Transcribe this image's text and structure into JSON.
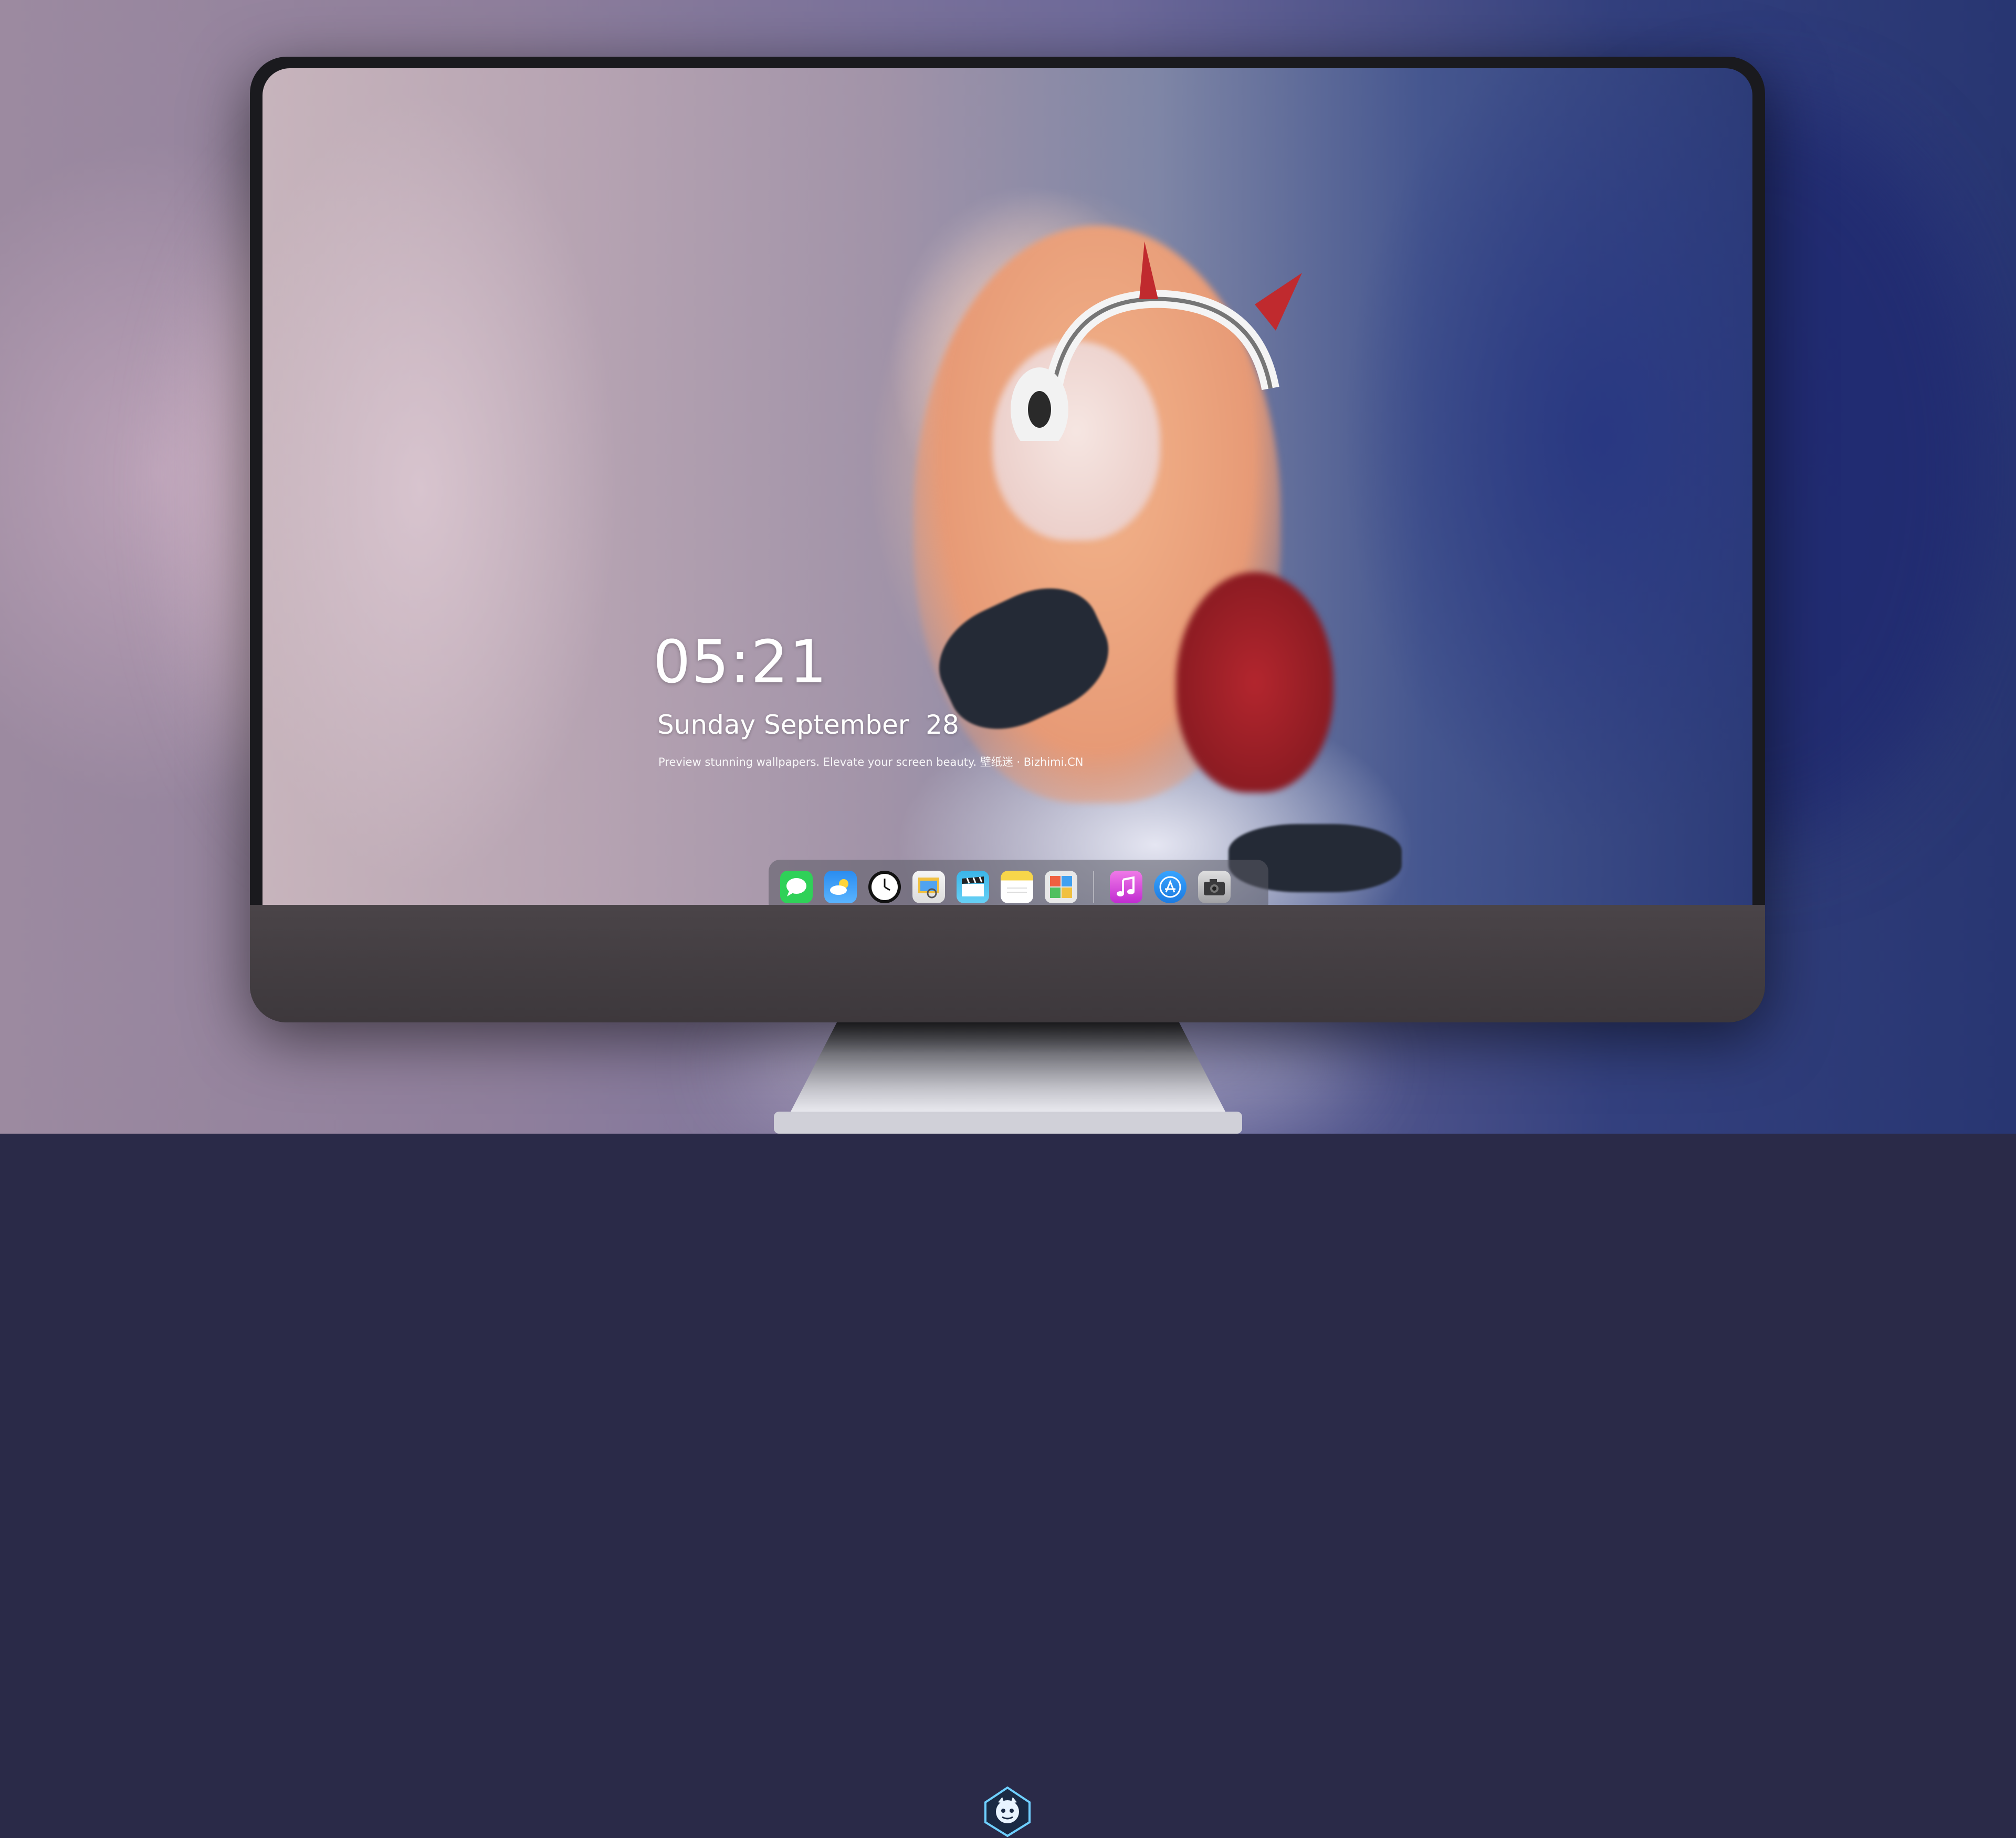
{
  "lockscreen": {
    "time": "05:21",
    "date": "Sunday September  28",
    "tagline": "Preview stunning wallpapers. Elevate your screen beauty. 壁纸迷 · Bizhimi.CN"
  },
  "dock": {
    "apps": [
      {
        "name": "messages-icon",
        "color": "#2fd158"
      },
      {
        "name": "weather-icon",
        "color": "#2a8cf0"
      },
      {
        "name": "clock-icon",
        "color": "#111111"
      },
      {
        "name": "preview-icon",
        "color": "#f0c040"
      },
      {
        "name": "clapperboard-icon",
        "color": "#3ab5e8"
      },
      {
        "name": "notes-icon",
        "color": "#f7d64a"
      },
      {
        "name": "photo-gallery-icon",
        "color": "#e8e8e8"
      },
      {
        "name": "music-icon",
        "color": "#d63bd8"
      },
      {
        "name": "app-store-icon",
        "color": "#1c8ef5"
      },
      {
        "name": "camera-icon",
        "color": "#3a3a3c"
      }
    ]
  },
  "colors": {
    "monitor_bezel": "#1a1a1e",
    "monitor_chin": "#4a4448",
    "text": "#ffffff"
  }
}
